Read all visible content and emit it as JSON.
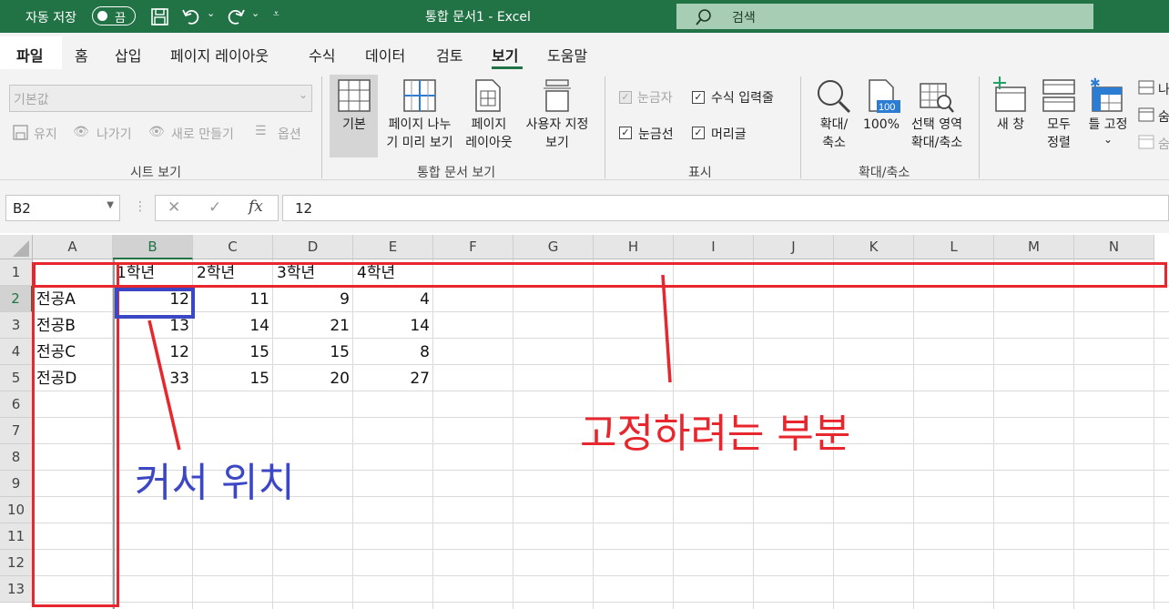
{
  "titlebar": {
    "autosave_label": "자동 저장",
    "autosave_state": "끔",
    "doc_title": "통합 문서1  -  Excel",
    "search_placeholder": "검색"
  },
  "tabs": [
    {
      "label": "파일"
    },
    {
      "label": "홈"
    },
    {
      "label": "삽입"
    },
    {
      "label": "페이지 레이아웃"
    },
    {
      "label": "수식"
    },
    {
      "label": "데이터"
    },
    {
      "label": "검토"
    },
    {
      "label": "보기"
    },
    {
      "label": "도움말"
    }
  ],
  "ribbon": {
    "sheet_view": {
      "dropdown_value": "기본값",
      "keep": "유지",
      "exit": "나가기",
      "new": "새로 만들기",
      "options": "옵션",
      "group_label": "시트 보기"
    },
    "workbook_views": {
      "normal": "기본",
      "page_break_l1": "페이지 나누",
      "page_break_l2": "기 미리 보기",
      "page_layout_l1": "페이지",
      "page_layout_l2": "레이아웃",
      "custom_l1": "사용자 지정",
      "custom_l2": "보기",
      "group_label": "통합 문서 보기"
    },
    "show": {
      "ruler": "눈금자",
      "formula_bar": "수식 입력줄",
      "gridlines": "눈금선",
      "headings": "머리글",
      "group_label": "표시"
    },
    "zoom": {
      "zoom_l1": "확대/",
      "zoom_l2": "축소",
      "hundred": "100%",
      "sel_l1": "선택 영역",
      "sel_l2": "확대/축소",
      "hundred_icon_text": "100",
      "group_label": "확대/축소"
    },
    "window": {
      "new_window": "새 창",
      "arrange_l1": "모두",
      "arrange_l2": "정렬",
      "freeze": "틀 고정",
      "freeze_caret": "⌄",
      "split_partial": "나",
      "hide_partial": "숨",
      "unhide_partial": "숨"
    }
  },
  "formula_bar": {
    "name_box": "B2",
    "cancel": "✕",
    "enter": "✓",
    "fx": "fx",
    "formula": "12"
  },
  "sheet": {
    "columns": [
      "A",
      "B",
      "C",
      "D",
      "E",
      "F",
      "G",
      "H",
      "I",
      "J",
      "K",
      "L",
      "M",
      "N"
    ],
    "rows": [
      "1",
      "2",
      "3",
      "4",
      "5",
      "6",
      "7",
      "8",
      "9",
      "10",
      "11",
      "12",
      "13"
    ],
    "header_row": [
      "1학년",
      "2학년",
      "3학년",
      "4학년"
    ],
    "data_rows": [
      {
        "label": "전공A",
        "values": [
          "12",
          "11",
          "9",
          "4"
        ]
      },
      {
        "label": "전공B",
        "values": [
          "13",
          "14",
          "21",
          "14"
        ]
      },
      {
        "label": "전공C",
        "values": [
          "12",
          "15",
          "15",
          "8"
        ]
      },
      {
        "label": "전공D",
        "values": [
          "33",
          "15",
          "20",
          "27"
        ]
      }
    ],
    "selected_cell": "B2"
  },
  "annotations": {
    "freeze_label": "고정하려는 부분",
    "cursor_label": "커서 위치",
    "red": "#e8262d",
    "blue": "#3c47c6"
  },
  "colors": {
    "excel_green": "#217346"
  }
}
